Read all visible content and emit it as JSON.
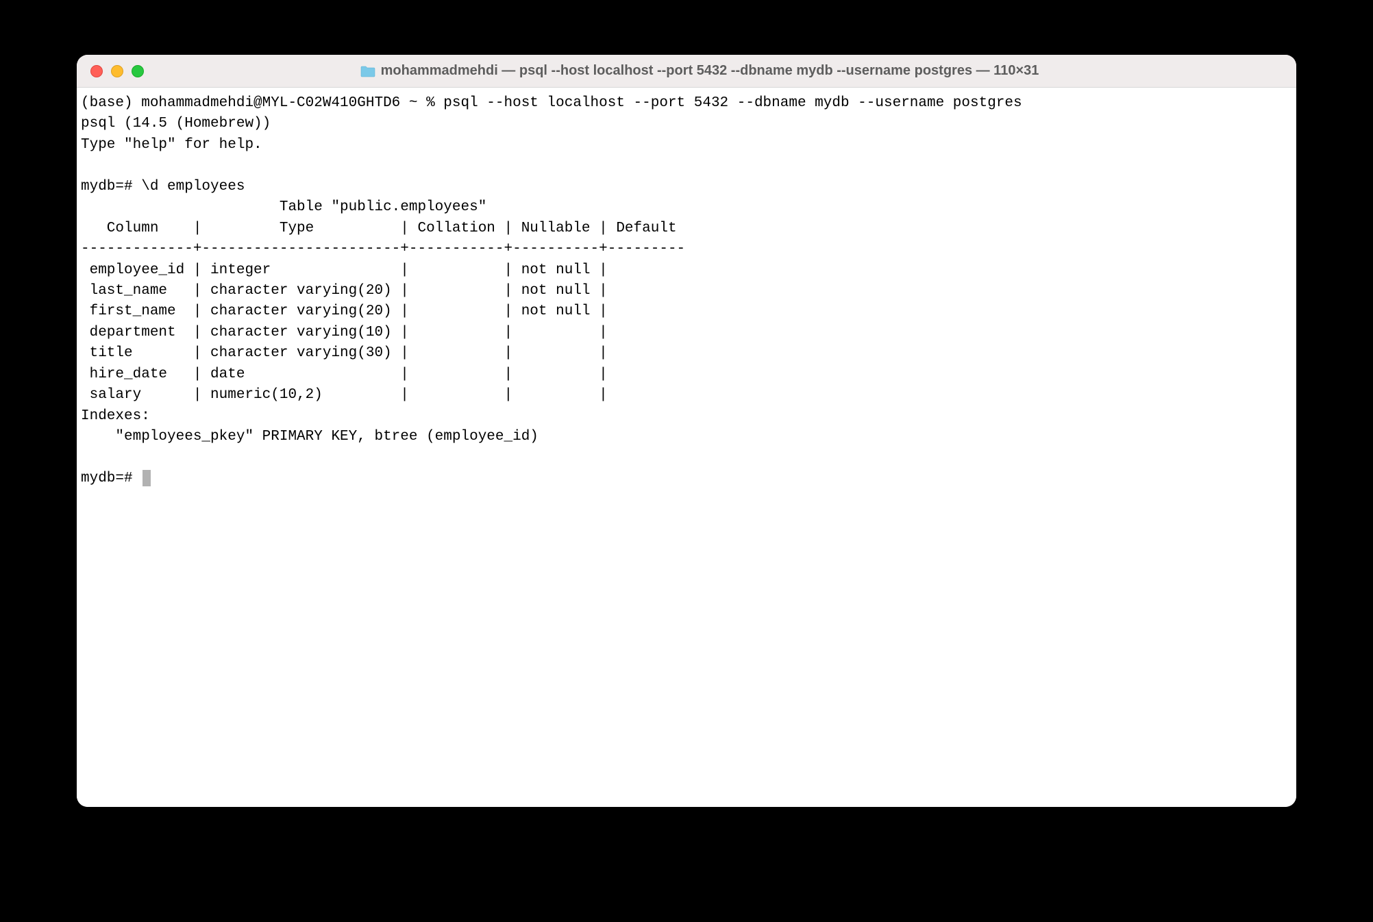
{
  "titlebar": {
    "title": "mohammadmehdi — psql --host localhost --port 5432 --dbname mydb --username postgres — 110×31"
  },
  "terminal": {
    "line1": "(base) mohammadmehdi@MYL-C02W410GHTD6 ~ % psql --host localhost --port 5432 --dbname mydb --username postgres",
    "line2": "psql (14.5 (Homebrew))",
    "line3": "Type \"help\" for help.",
    "blank1": " ",
    "cmd1": "mydb=# \\d employees",
    "tableTitle": "                       Table \"public.employees\"",
    "header": "   Column    |         Type          | Collation | Nullable | Default ",
    "divider": "-------------+-----------------------+-----------+----------+---------",
    "row1": " employee_id | integer               |           | not null | ",
    "row2": " last_name   | character varying(20) |           | not null | ",
    "row3": " first_name  | character varying(20) |           | not null | ",
    "row4": " department  | character varying(10) |           |          | ",
    "row5": " title       | character varying(30) |           |          | ",
    "row6": " hire_date   | date                  |           |          | ",
    "row7": " salary      | numeric(10,2)         |           |          | ",
    "indexesLabel": "Indexes:",
    "indexLine": "    \"employees_pkey\" PRIMARY KEY, btree (employee_id)",
    "blank2": " ",
    "prompt2": "mydb=# "
  }
}
